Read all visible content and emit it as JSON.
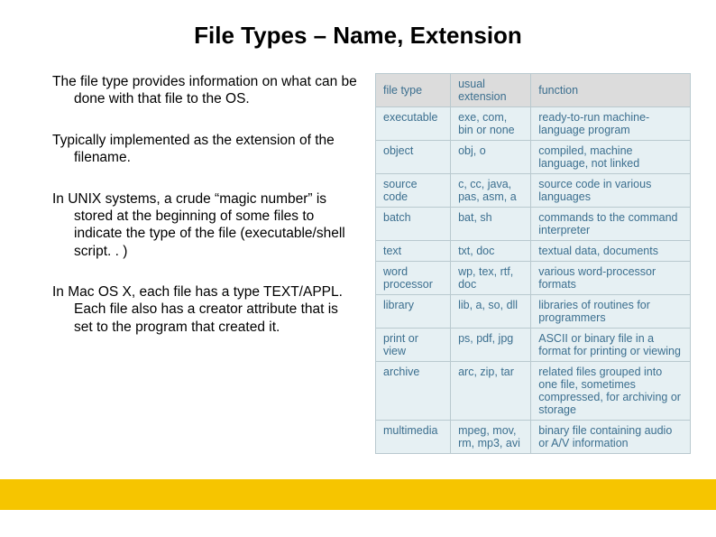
{
  "title": "File Types – Name, Extension",
  "paragraphs": [
    "The file type provides information on what can be done with that file to the OS.",
    "Typically implemented as the extension of the filename.",
    "In UNIX systems, a crude “magic number” is stored at the beginning of some files to indicate the type of the file (executable/shell script. . )",
    "In Mac OS X, each file has a type TEXT/APPL. Each file also has a creator attribute that is set to the program that created it."
  ],
  "table": {
    "headers": [
      "file type",
      "usual extension",
      "function"
    ],
    "rows": [
      [
        "executable",
        "exe, com, bin or none",
        "ready-to-run machine-language program"
      ],
      [
        "object",
        "obj, o",
        "compiled, machine language, not linked"
      ],
      [
        "source code",
        "c, cc, java, pas, asm, a",
        "source code in various languages"
      ],
      [
        "batch",
        "bat, sh",
        "commands to the command interpreter"
      ],
      [
        "text",
        "txt, doc",
        "textual data, documents"
      ],
      [
        "word processor",
        "wp, tex, rtf, doc",
        "various word-processor formats"
      ],
      [
        "library",
        "lib, a, so, dll",
        "libraries of routines for programmers"
      ],
      [
        "print or view",
        "ps, pdf, jpg",
        "ASCII or binary file in a format for printing or viewing"
      ],
      [
        "archive",
        "arc, zip, tar",
        "related files grouped into one file, sometimes compressed, for archiving or storage"
      ],
      [
        "multimedia",
        "mpeg, mov, rm, mp3, avi",
        "binary file containing audio or A/V information"
      ]
    ]
  }
}
